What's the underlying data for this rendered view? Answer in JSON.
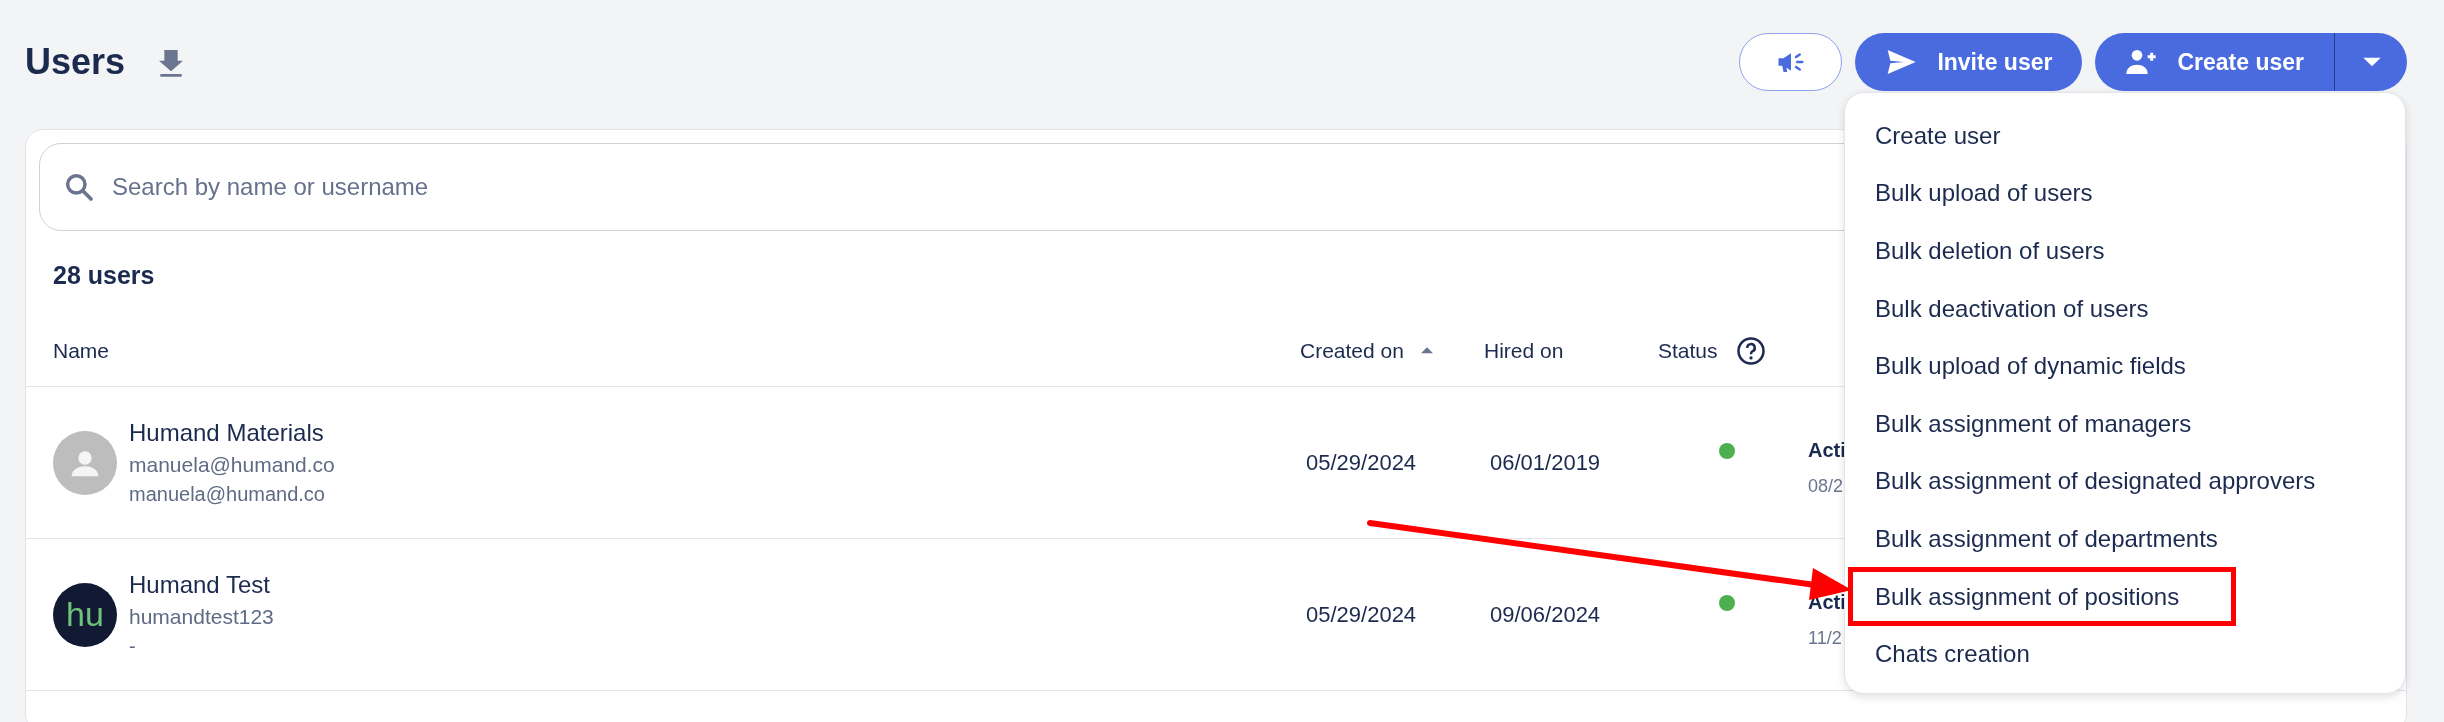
{
  "page": {
    "title": "Users"
  },
  "header_buttons": [
    {
      "kind": "announce"
    },
    {
      "kind": "invite",
      "label": "Invite user"
    },
    {
      "kind": "create",
      "label": "Create user"
    }
  ],
  "search": {
    "placeholder": "Search by name or username"
  },
  "count": "28 users",
  "table": {
    "columns": [
      {
        "label": "Name"
      },
      {
        "label": "Created on",
        "sorted": true
      },
      {
        "label": "Hired on"
      },
      {
        "label": "Status",
        "help": true
      }
    ],
    "rows": [
      {
        "name": "Humand Materials",
        "username": "manuela@humand.co",
        "email": "manuela@humand.co",
        "avatar": {
          "kind": "placeholder"
        },
        "created_on": "05/29/2024",
        "hired_on": "06/01/2019",
        "status": {
          "color": "#4caf50"
        },
        "column_5": "Acti",
        "column_5_date": "08/2"
      },
      {
        "name": "Humand Test",
        "username": "humandtest123",
        "email": "-",
        "avatar": {
          "kind": "initials",
          "text": "hu"
        },
        "created_on": "05/29/2024",
        "hired_on": "09/06/2024",
        "status": {
          "color": "#4caf50"
        },
        "column_5": "Acti",
        "column_5_date": "11/2"
      }
    ]
  },
  "create_menu": {
    "expanded": true,
    "items": [
      {
        "label": "Create user",
        "highlighted": false
      },
      {
        "label": "Bulk upload of users",
        "highlighted": false
      },
      {
        "label": "Bulk deletion of users",
        "highlighted": false
      },
      {
        "label": "Bulk deactivation of users",
        "highlighted": false
      },
      {
        "label": "Bulk upload of dynamic fields",
        "highlighted": false
      },
      {
        "label": "Bulk assignment of managers",
        "highlighted": false
      },
      {
        "label": "Bulk assignment of designated approvers",
        "highlighted": false
      },
      {
        "label": "Bulk assignment of departments",
        "highlighted": false
      },
      {
        "label": "Bulk assignment of positions",
        "highlighted": true
      },
      {
        "label": "Chats creation",
        "highlighted": false
      }
    ]
  }
}
